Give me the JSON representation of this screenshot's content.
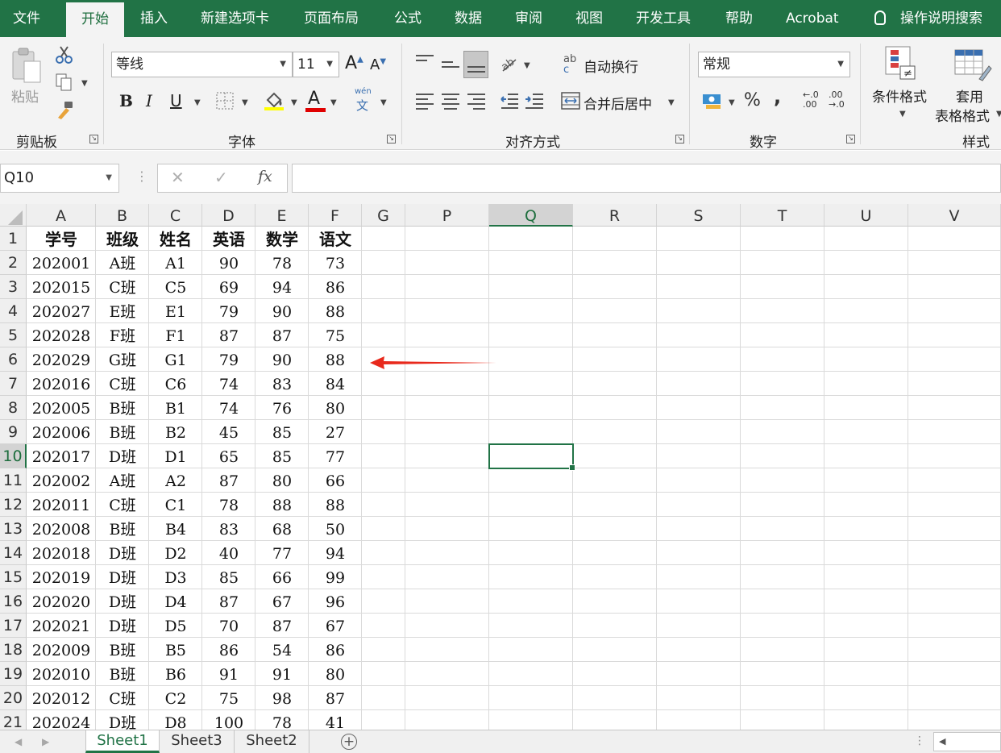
{
  "ribbon_tabs": [
    "文件",
    "开始",
    "插入",
    "新建选项卡",
    "页面布局",
    "公式",
    "数据",
    "审阅",
    "视图",
    "开发工具",
    "帮助",
    "Acrobat"
  ],
  "active_tab": "开始",
  "tell_me": "操作说明搜索",
  "clipboard": {
    "paste": "粘贴",
    "group": "剪贴板"
  },
  "font": {
    "name": "等线",
    "size": "11",
    "bold": "B",
    "italic": "I",
    "underline": "U",
    "font_color_glyph": "A",
    "phonetic_top": "wén",
    "phonetic_bottom": "文",
    "group": "字体",
    "grow": "A",
    "shrink": "A"
  },
  "alignment": {
    "wrap": "自动换行",
    "merge": "合并后居中",
    "group": "对齐方式",
    "wrap_glyph_top": "ab",
    "wrap_glyph_bottom": "c"
  },
  "number": {
    "format": "常规",
    "percent": "%",
    "comma": ",",
    "inc_decimal_top": "←.0",
    "inc_decimal_bottom": ".00",
    "dec_decimal_top": ".00",
    "dec_decimal_bottom": "→.0",
    "group": "数字"
  },
  "styles": {
    "conditional": "条件格式",
    "table_top": "套用",
    "table_bottom": "表格格式",
    "group": "样式"
  },
  "formula_bar": {
    "name_box": "Q10",
    "fx": "fx",
    "cancel": "✕",
    "enter": "✓",
    "content": ""
  },
  "columns": [
    "A",
    "B",
    "C",
    "D",
    "E",
    "F",
    "G",
    "P",
    "Q",
    "R",
    "S",
    "T",
    "U",
    "V"
  ],
  "selected_column": "Q",
  "selected_row": "10",
  "selected_cell": "Q10",
  "table_header": [
    "学号",
    "班级",
    "姓名",
    "英语",
    "数学",
    "语文"
  ],
  "rows": [
    [
      "202001",
      "A班",
      "A1",
      "90",
      "78",
      "73"
    ],
    [
      "202015",
      "C班",
      "C5",
      "69",
      "94",
      "86"
    ],
    [
      "202027",
      "E班",
      "E1",
      "79",
      "90",
      "88"
    ],
    [
      "202028",
      "F班",
      "F1",
      "87",
      "87",
      "75"
    ],
    [
      "202029",
      "G班",
      "G1",
      "79",
      "90",
      "88"
    ],
    [
      "202016",
      "C班",
      "C6",
      "74",
      "83",
      "84"
    ],
    [
      "202005",
      "B班",
      "B1",
      "74",
      "76",
      "80"
    ],
    [
      "202006",
      "B班",
      "B2",
      "45",
      "85",
      "27"
    ],
    [
      "202017",
      "D班",
      "D1",
      "65",
      "85",
      "77"
    ],
    [
      "202002",
      "A班",
      "A2",
      "87",
      "80",
      "66"
    ],
    [
      "202011",
      "C班",
      "C1",
      "78",
      "88",
      "88"
    ],
    [
      "202008",
      "B班",
      "B4",
      "83",
      "68",
      "50"
    ],
    [
      "202018",
      "D班",
      "D2",
      "40",
      "77",
      "94"
    ],
    [
      "202019",
      "D班",
      "D3",
      "85",
      "66",
      "99"
    ],
    [
      "202020",
      "D班",
      "D4",
      "87",
      "67",
      "96"
    ],
    [
      "202021",
      "D班",
      "D5",
      "70",
      "87",
      "67"
    ],
    [
      "202009",
      "B班",
      "B5",
      "86",
      "54",
      "86"
    ],
    [
      "202010",
      "B班",
      "B6",
      "91",
      "91",
      "80"
    ],
    [
      "202012",
      "C班",
      "C2",
      "75",
      "98",
      "87"
    ],
    [
      "202024",
      "D班",
      "D8",
      "100",
      "78",
      "41"
    ]
  ],
  "annotation": {
    "color": "#e8291c",
    "points_to_row": "6"
  },
  "sheets": [
    "Sheet1",
    "Sheet3",
    "Sheet2"
  ],
  "active_sheet": "Sheet1",
  "add_sheet": "+",
  "colors": {
    "excel_green": "#217346",
    "font_color_bar": "#e00000"
  }
}
